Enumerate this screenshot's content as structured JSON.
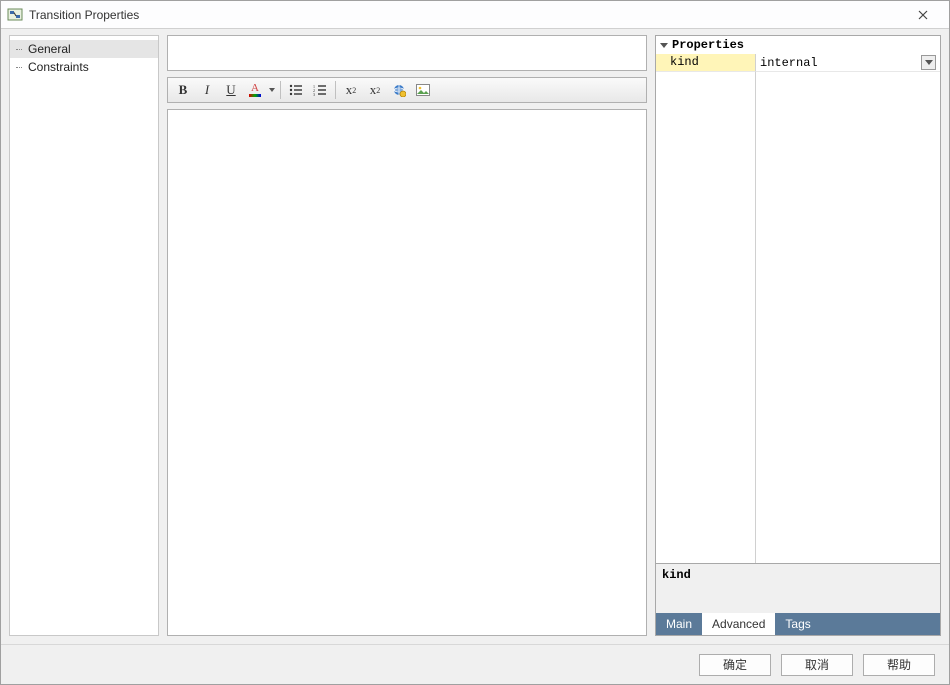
{
  "window": {
    "title": "Transition Properties"
  },
  "nav": {
    "items": [
      {
        "label": "General"
      },
      {
        "label": "Constraints"
      }
    ],
    "selected_index": 0
  },
  "editor": {
    "name_value": "",
    "body_value": ""
  },
  "toolbar": {
    "bold": "B",
    "italic": "I",
    "underline": "U",
    "fontcolor": "A",
    "sup_label": "x",
    "sup_exp": "2",
    "sub_label": "x",
    "sub_exp": "2"
  },
  "properties": {
    "header": "Properties",
    "rows": [
      {
        "key": "kind",
        "value": "internal"
      }
    ],
    "description": "kind"
  },
  "tabs": {
    "items": [
      {
        "label": "Main"
      },
      {
        "label": "Advanced"
      },
      {
        "label": "Tags"
      }
    ],
    "active_index": 1
  },
  "buttons": {
    "ok": "确定",
    "cancel": "取消",
    "help": "帮助"
  }
}
